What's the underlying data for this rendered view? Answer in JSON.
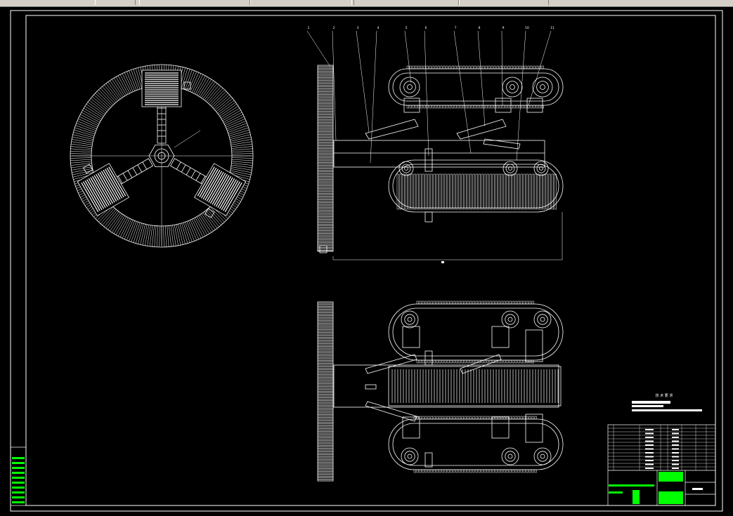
{
  "toolbar": {
    "items": [
      "",
      "",
      "",
      "",
      "",
      ""
    ]
  },
  "drawing": {
    "callouts": [
      "1",
      "2",
      "3",
      "4",
      "5",
      "6",
      "7",
      "8",
      "9",
      "10",
      "11"
    ],
    "title_block": {
      "requirements_heading": "技 术 要 求",
      "drawing_name": ""
    }
  },
  "colors": {
    "background": "#000000",
    "line": "#ffffff",
    "title_green": "#00ff00",
    "toolbar": "#d4d0c8"
  }
}
